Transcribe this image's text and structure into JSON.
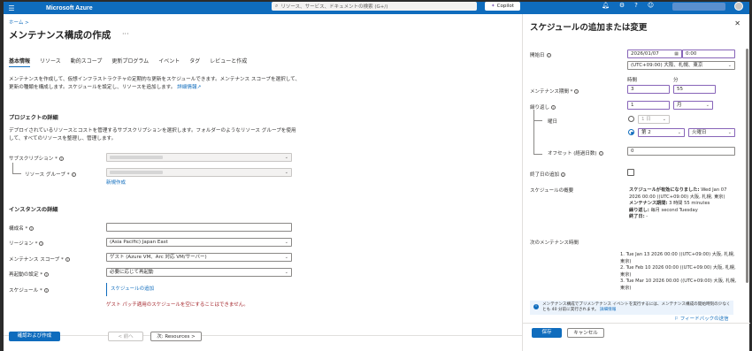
{
  "topbar": {
    "brand": "Microsoft Azure",
    "search_placeholder": "リソース、サービス、ドキュメントの検索 (G+/)",
    "copilot": "Copilot"
  },
  "breadcrumb": "ホーム >",
  "page_title": "メンテナンス構成の作成",
  "tabs": [
    "基本情報",
    "リソース",
    "動的スコープ",
    "更新プログラム",
    "イベント",
    "タグ",
    "レビューと作成"
  ],
  "description": {
    "text": "メンテナンスを作成して、仮想インフラストラクチャの定期的な更新をスケジュールできます。メンテナンス スコープを選択して、更新の種類を構成します。スケジュールを設定し、リソースを追加します。",
    "link": "詳細情報"
  },
  "project": {
    "heading": "プロジェクトの詳細",
    "text": "デプロイされているリソースとコストを管理するサブスクリプションを選択します。フォルダーのようなリソース グループを使用して、すべてのリソースを整理し、管理します。",
    "subscription_label": "サブスクリプション *",
    "resource_group_label": "リソース グループ *",
    "new_link": "新規作成"
  },
  "instance": {
    "heading": "インスタンスの詳細",
    "name_label": "構成名 *",
    "region_label": "リージョン *",
    "region_value": "(Asia Pacific) Japan East",
    "scope_label": "メンテナンス スコープ *",
    "scope_value": "ゲスト (Azure VM、Arc 対応 VM/サーバー)",
    "reboot_label": "再起動の設定 *",
    "reboot_value": "必要に応じて再起動",
    "schedule_label": "スケジュール *",
    "schedule_link": "スケジュールの追加",
    "error": "ゲスト パッチ適用のスケジュールを空にすることはできません。"
  },
  "footer": {
    "review_create": "確認および作成",
    "prev": "< 前へ",
    "next": "次: Resources >"
  },
  "panel": {
    "title": "スケジュールの追加または変更",
    "start_label": "開始日",
    "start_date": "2026/01/07",
    "start_time": "0:00",
    "timezone": "(UTC+09:00) 大阪、札幌、東京",
    "duration_label": "メンテナンス期間 *",
    "hours_header": "時間",
    "minutes_header": "分",
    "hours": "3",
    "minutes": "55",
    "repeat_label": "繰り返し",
    "repeat_value": "1",
    "repeat_unit": "月",
    "day_label": "曜日",
    "option_day": "1 日",
    "option_week": "第 2",
    "weekday": "火曜日",
    "offset_label": "オフセット (経過日数)",
    "offset_value": "0",
    "end_label": "終了日の追加",
    "summary_label": "スケジュールの概要",
    "summary_line1_bold": "スケジュールが有効になりました:",
    "summary_line1": "Wed Jan 07 2026 00:00 ((UTC+09:00) 大阪, 札幌, 東京)",
    "summary_duration_bold": "メンテナンス期間:",
    "summary_duration": "3 時間 55 minutes",
    "summary_repeat_bold": "繰り返し:",
    "summary_repeat": "毎月 second Tuesday",
    "summary_end_bold": "終了日:",
    "summary_end": "-",
    "next_label": "次のメンテナンス時間",
    "next_times": [
      "1. Tue Jan 13 2026 00:00 ((UTC+09:00) 大阪, 札幌, 東京)",
      "2. Tue Feb 10 2026 00:00 ((UTC+09:00) 大阪, 札幌, 東京)",
      "3. Tue Mar 10 2026 00:00 ((UTC+09:00) 大阪, 札幌, 東京)"
    ],
    "info": "メンテナンス構成でプリメンテナンス イベントを実行するには、メンテナンス構成の開始時刻の少なくとも 40 分前に実行されます。",
    "info_link": "詳細情報",
    "save": "保存",
    "cancel": "キャンセル",
    "feedback": "フィードバックの送信"
  }
}
